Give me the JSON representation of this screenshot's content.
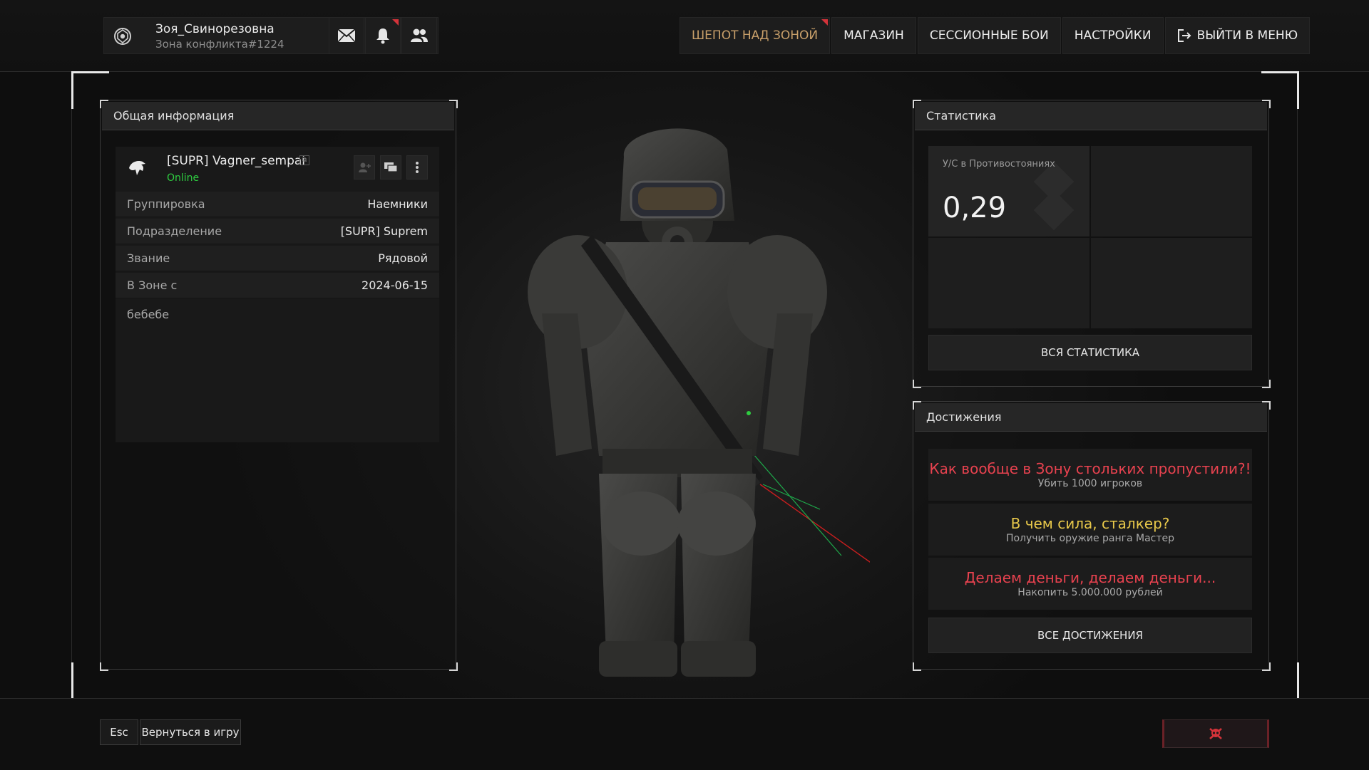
{
  "player": {
    "name": "Зоя_Свинорезовна",
    "zone": "Зона конфликта#1224",
    "emblem_icon": "faction-emblem-icon"
  },
  "top_icons": {
    "mail_icon": "mail-icon",
    "notifications_icon": "bell-icon",
    "friends_icon": "friends-icon"
  },
  "nav": {
    "items": [
      {
        "label": "ШЕПОТ НАД ЗОНОЙ",
        "active": true,
        "flag": true
      },
      {
        "label": "МАГАЗИН"
      },
      {
        "label": "СЕССИОННЫЕ БОИ"
      },
      {
        "label": "НАСТРОЙКИ"
      }
    ],
    "exit_label": "ВЫЙТИ В МЕНЮ",
    "exit_icon": "exit-icon"
  },
  "general": {
    "title": "Общая информация",
    "profile": {
      "name": "[SUPR] Vagner_sempai",
      "status": "Online",
      "status_color": "#2ecc40",
      "avatar_icon": "eagle-emblem-icon"
    },
    "rows": [
      {
        "key": "Группировка",
        "value": "Наемники"
      },
      {
        "key": "Подразделение",
        "value": "[SUPR] Suprem"
      },
      {
        "key": "Звание",
        "value": "Рядовой"
      },
      {
        "key": "В Зоне с",
        "value": "2024-06-15"
      }
    ],
    "bio": "бебебе"
  },
  "stats": {
    "title": "Статистика",
    "kd_label": "У/С в Противостояниях",
    "kd_value": "0,29",
    "all_label": "ВСЯ СТАТИСТИКА"
  },
  "achievements": {
    "title": "Достижения",
    "items": [
      {
        "title": "Как вообще в Зону стольких пропустили?!",
        "desc": "Убить 1000 игроков",
        "color": "#e8424f"
      },
      {
        "title": "В чем сила, сталкер?",
        "desc": "Получить оружие ранга Мастер",
        "color": "#e8c84a"
      },
      {
        "title": "Делаем деньги, делаем деньги...",
        "desc": "Накопить 5.000.000 рублей",
        "color": "#e8424f"
      }
    ],
    "all_label": "ВСЕ ДОСТИЖЕНИЯ"
  },
  "footer": {
    "esc_key": "Esc",
    "return_label": "Вернуться в игру",
    "skull_icon": "skull-crossbones-icon"
  },
  "colors": {
    "accent_gold": "#c9a06a",
    "alert_red": "#d4333a",
    "achievement_red": "#e8424f",
    "achievement_yellow": "#e8c84a"
  }
}
